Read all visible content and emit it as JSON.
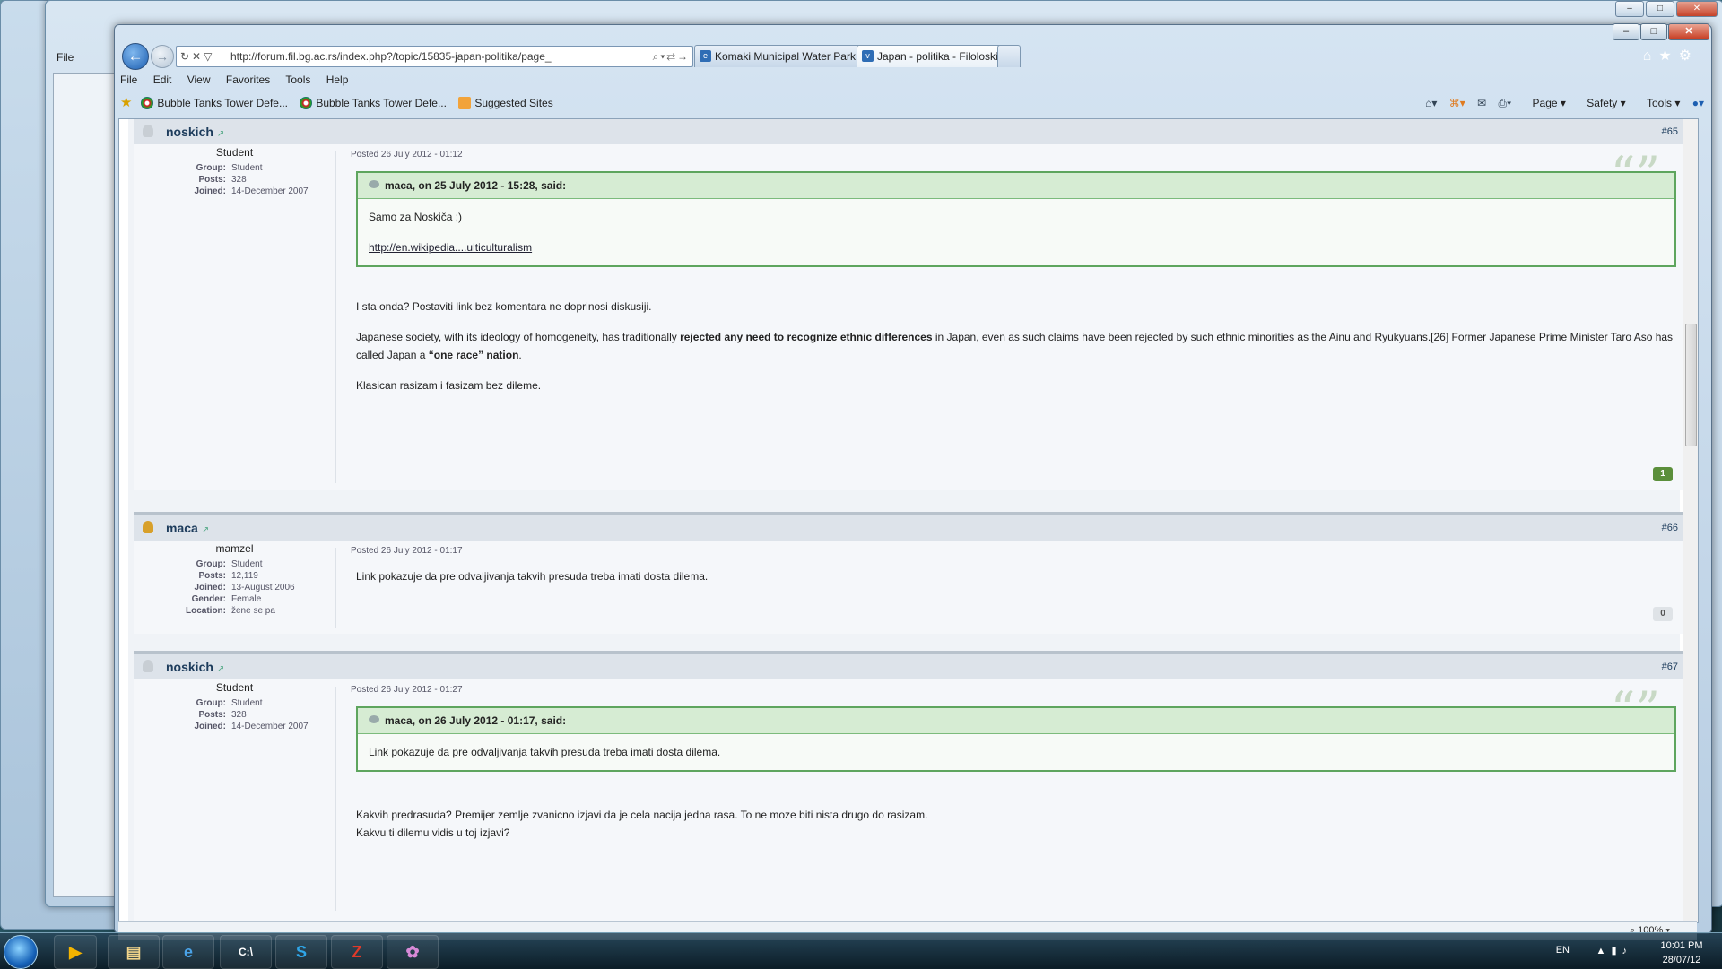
{
  "browser": {
    "address_url": "http://forum.fil.bg.ac.rs/index.php?/topic/15835-japan-politika/page_",
    "tabs": [
      {
        "label": "Komaki Municipal Water Park ..."
      },
      {
        "label": "Japan - politika - Filoloski fa..."
      }
    ],
    "menu": [
      "File",
      "Edit",
      "View",
      "Favorites",
      "Tools",
      "Help"
    ],
    "favorites": [
      {
        "label": "Bubble Tanks Tower Defe..."
      },
      {
        "label": "Bubble Tanks Tower Defe..."
      },
      {
        "label": "Suggested Sites"
      }
    ],
    "commands": [
      "Page",
      "Safety",
      "Tools"
    ],
    "zoom": "100%"
  },
  "posts": [
    {
      "author": "noskich",
      "number": "#65",
      "member_title": "Student",
      "profile": [
        {
          "k": "Group:",
          "v": "Student"
        },
        {
          "k": "Posts:",
          "v": "328"
        },
        {
          "k": "Joined:",
          "v": "14-December 2007"
        }
      ],
      "posted": "Posted 26 July 2012 - 01:12",
      "quote": {
        "header": "maca, on 25 July 2012 - 15:28, said:",
        "line1": "Samo za Noskiča ;)",
        "link": "http://en.wikipedia....ulticulturalism"
      },
      "para1": "I sta onda? Postaviti link bez komentara ne doprinosi diskusiji.",
      "para2_a": "Japanese society, with its ideology of homogeneity, has traditionally ",
      "para2_b": "rejected any need to recognize ethnic differences",
      "para2_c": " in Japan, even as such claims have been rejected by such ethnic minorities as the Ainu and Ryukyuans.[26] Former Japanese Prime Minister Taro Aso has called Japan a ",
      "para2_d": "“one race” nation",
      "para2_e": ".",
      "para3": "Klasican rasizam i fasizam bez dileme.",
      "rep": "1"
    },
    {
      "author": "maca",
      "number": "#66",
      "member_title": "mamzel",
      "profile": [
        {
          "k": "Group:",
          "v": "Student"
        },
        {
          "k": "Posts:",
          "v": "12,119"
        },
        {
          "k": "Joined:",
          "v": "13-August 2006"
        },
        {
          "k": "Gender:",
          "v": "Female"
        },
        {
          "k": "Location:",
          "v": "žene se pa"
        }
      ],
      "posted": "Posted 26 July 2012 - 01:17",
      "para1": "Link pokazuje da pre odvaljivanja takvih presuda treba imati dosta dilema.",
      "rep": "0"
    },
    {
      "author": "noskich",
      "number": "#67",
      "member_title": "Student",
      "profile": [
        {
          "k": "Group:",
          "v": "Student"
        },
        {
          "k": "Posts:",
          "v": "328"
        },
        {
          "k": "Joined:",
          "v": "14-December 2007"
        }
      ],
      "posted": "Posted 26 July 2012 - 01:27",
      "quote": {
        "header": "maca, on 26 July 2012 - 01:17, said:",
        "line1": "Link pokazuje da pre odvaljivanja takvih presuda treba imati dosta dilema."
      },
      "para1": "Kakvih predrasuda? Premijer zemlje zvanicno izjavi da je cela nacija jedna rasa. To ne moze biti nista drugo do rasizam.",
      "para1b": "Kakvu ti dilemu vidis u toj izjavi?",
      "rep": "1"
    }
  ],
  "taskbar": {
    "lang": "EN",
    "time": "10:01 PM",
    "date": "28/07/12"
  },
  "bg_window": {
    "menu_file": "File"
  },
  "colors": {
    "quote_border": "#5ea55e",
    "rep_positive": "#5b8f3b",
    "author": "#1d3c5c"
  }
}
